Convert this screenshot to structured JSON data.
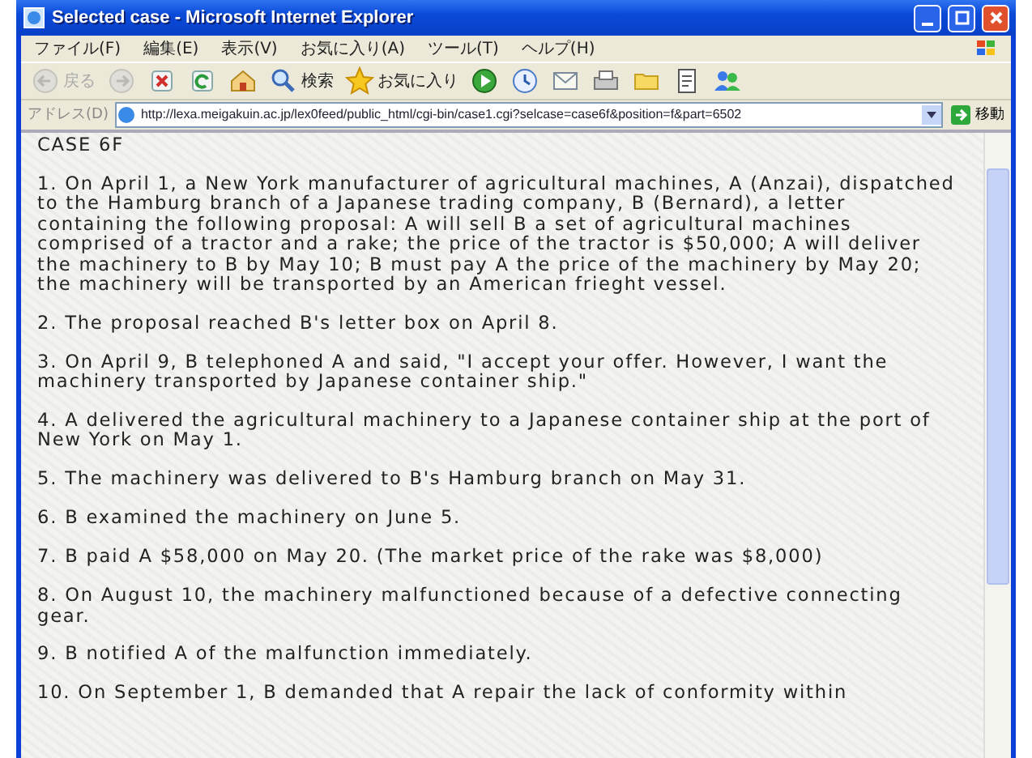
{
  "window": {
    "title": "Selected case - Microsoft Internet Explorer"
  },
  "menu": [
    "ファイル(F)",
    "編集(E)",
    "表示(V)",
    "お気に入り(A)",
    "ツール(T)",
    "ヘルプ(H)"
  ],
  "toolbar": [
    {
      "kind": "back",
      "label": "戻る",
      "disabled": true
    },
    {
      "kind": "forward",
      "disabled": true
    },
    {
      "kind": "stop",
      "disabled": false
    },
    {
      "kind": "refresh",
      "disabled": false
    },
    {
      "kind": "home",
      "disabled": false
    },
    {
      "kind": "search",
      "label": "検索",
      "disabled": false
    },
    {
      "kind": "favorites",
      "label": "お気に入り",
      "disabled": false
    },
    {
      "kind": "media",
      "disabled": false
    },
    {
      "kind": "history",
      "disabled": false
    },
    {
      "kind": "mail",
      "disabled": false
    },
    {
      "kind": "print",
      "disabled": false
    },
    {
      "kind": "edit",
      "disabled": false
    },
    {
      "kind": "discuss",
      "disabled": false
    },
    {
      "kind": "messenger",
      "disabled": false
    }
  ],
  "address": {
    "label": "アドレス(D)",
    "url": "http://lexa.meigakuin.ac.jp/lex0feed/public_html/cgi-bin/case1.cgi?selcase=case6f&position=f&part=6502",
    "go": "移動"
  },
  "document": {
    "heading": "CASE 6F",
    "paragraphs": [
      "1. On April 1, a New York manufacturer of agricultural machines, A (Anzai), dispatched to the Hamburg branch of a Japanese trading company, B (Bernard), a letter containing the following proposal: A will sell B a set of agricultural machines comprised of a tractor and a rake; the price of the tractor is $50,000; A will deliver the machinery to B by May 10; B must pay A the price of the machinery by May 20; the machinery will be transported by an American frieght vessel.",
      "2. The proposal reached B's letter box on April 8.",
      "3. On April 9, B telephoned A and said, \"I accept your offer. However, I want the machinery transported by Japanese container ship.\"",
      "4. A delivered the agricultural machinery to a Japanese container ship at the port of New York on May 1.",
      "5. The machinery was delivered to B's Hamburg branch on May 31.",
      "6. B examined the machinery on June 5.",
      "7. B paid A $58,000 on May 20. (The market price of the rake was $8,000)",
      "8. On August 10, the machinery malfunctioned because of a defective connecting gear.",
      "9. B notified A of the malfunction immediately.",
      "10. On September 1, B demanded that A repair the lack of conformity within"
    ]
  }
}
